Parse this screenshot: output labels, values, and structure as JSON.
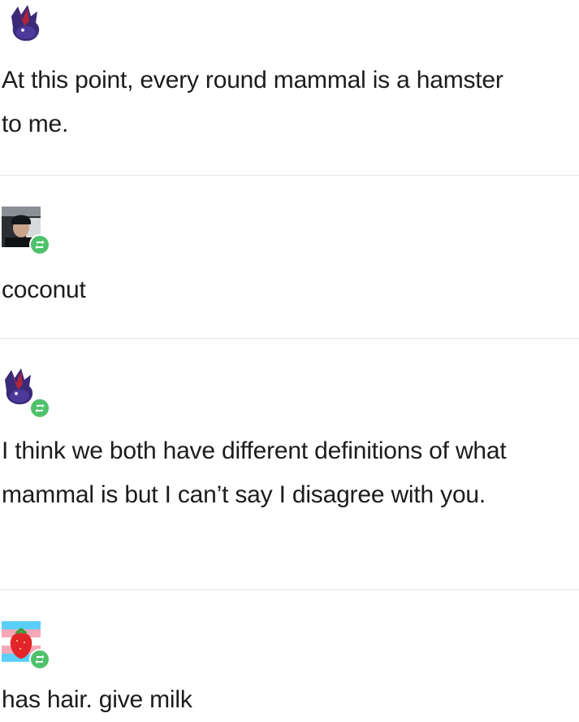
{
  "posts": [
    {
      "avatar_icon": "bat-creature-avatar-icon",
      "reblogged": false,
      "text": "At this point, every round mammal is a hamster to me."
    },
    {
      "avatar_icon": "person-photo-avatar-icon",
      "reblogged": true,
      "text": "coconut"
    },
    {
      "avatar_icon": "bat-creature-avatar-icon",
      "reblogged": true,
      "text": "I think we both have different definitions of what mammal is but I can’t say I disagree with you."
    },
    {
      "avatar_icon": "strawberry-flag-avatar-icon",
      "reblogged": true,
      "text": "has hair. give milk"
    }
  ],
  "colors": {
    "reblog_badge": "#4fc16c",
    "divider": "#e6e6e6",
    "text": "#1c1c1c"
  }
}
